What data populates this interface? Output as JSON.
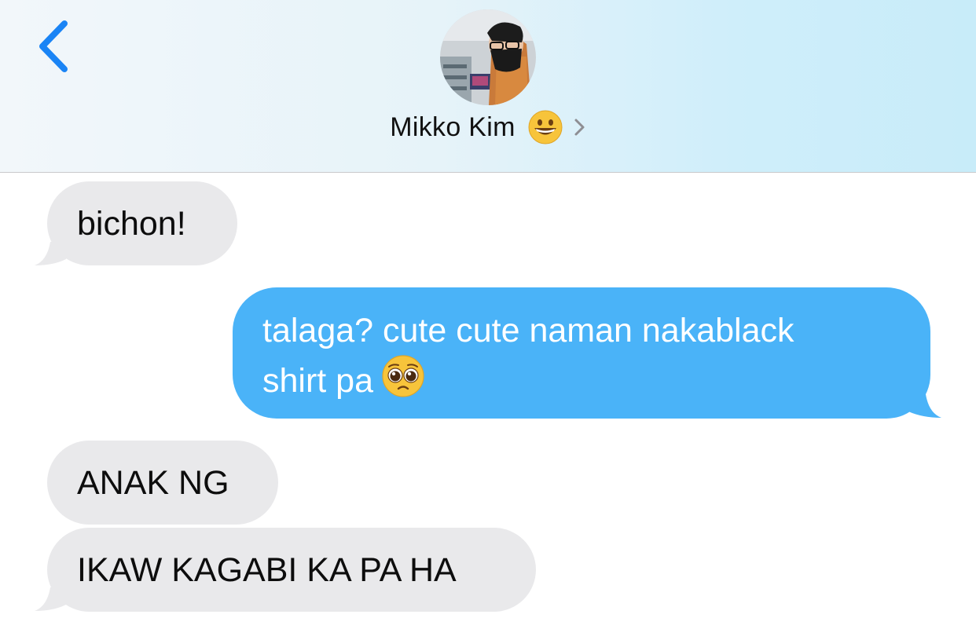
{
  "header": {
    "contact_name": "Mikko Kim",
    "name_emoji": "grinning-face-emoji",
    "back_icon": "chevron-left-icon",
    "details_icon": "chevron-right-icon",
    "avatar": "contact-avatar-photo"
  },
  "messages": [
    {
      "direction": "incoming",
      "text": "bichon!",
      "tail": true
    },
    {
      "direction": "outgoing",
      "line1": "talaga? cute cute naman nakablack",
      "line2": "shirt pa",
      "emoji": "pleading-face-emoji",
      "tail": true
    },
    {
      "direction": "incoming",
      "text": "ANAK NG",
      "tail": false
    },
    {
      "direction": "incoming",
      "text": "IKAW KAGABI KA PA HA",
      "tail": true
    }
  ],
  "colors": {
    "accent": "#1a84f5",
    "incoming_bubble": "#e9e9eb",
    "outgoing_bubble": "#4ab3f8",
    "header_gradient_start": "#f2f7fa",
    "header_gradient_end": "#c8ecf9"
  }
}
